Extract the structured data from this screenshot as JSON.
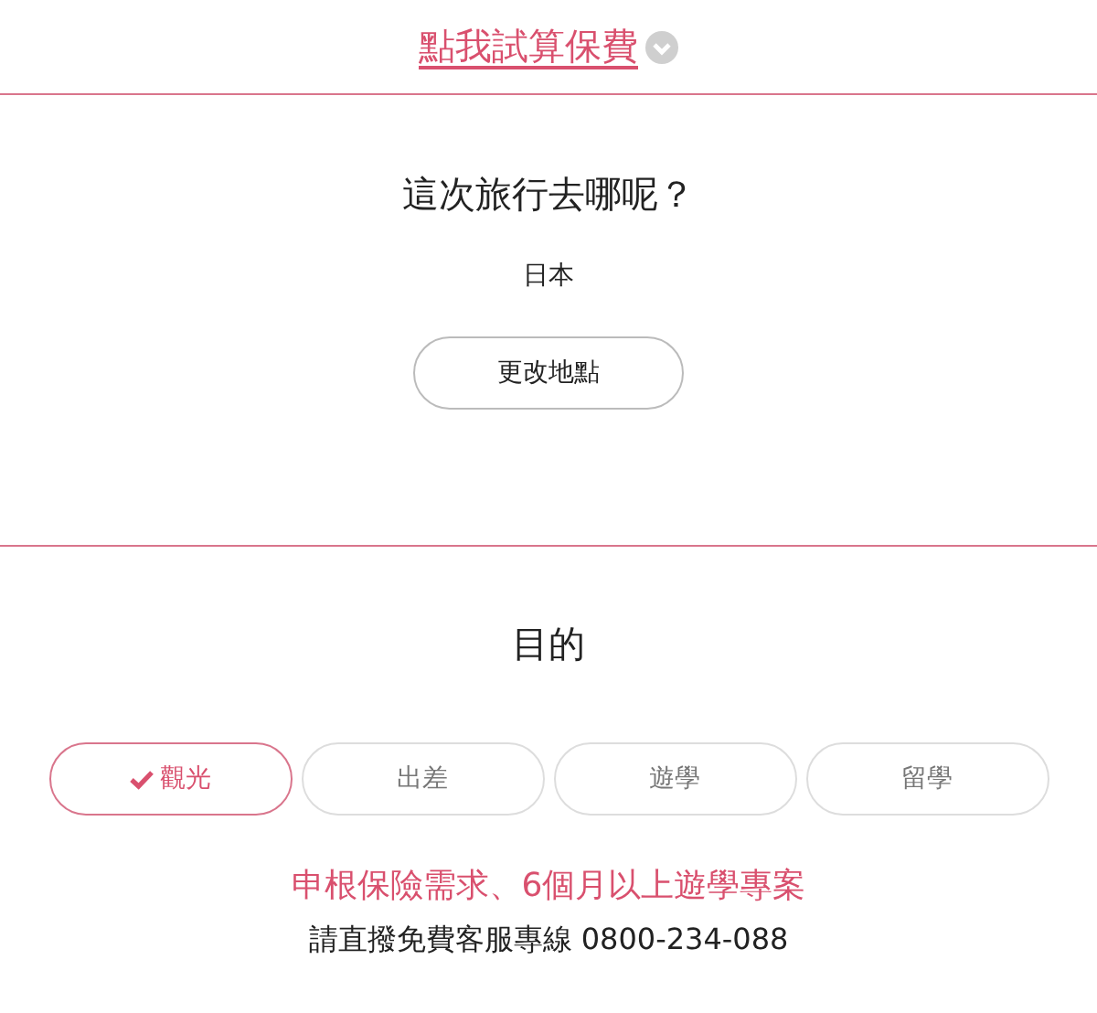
{
  "quote_link": {
    "label": "點我試算保費"
  },
  "destination": {
    "question": "這次旅行去哪呢？",
    "value": "日本",
    "button": "更改地點"
  },
  "purpose": {
    "heading": "目的",
    "options": [
      {
        "label": "觀光",
        "selected": true
      },
      {
        "label": "出差",
        "selected": false
      },
      {
        "label": "遊學",
        "selected": false
      },
      {
        "label": "留學",
        "selected": false
      }
    ],
    "notice": "申根保險需求、6個月以上遊學專案",
    "hotline": "請直撥免費客服專線 0800-234-088"
  }
}
